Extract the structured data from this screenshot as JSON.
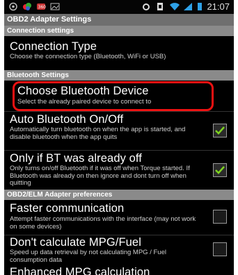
{
  "status_bar": {
    "time": "21:07",
    "icons_left": [
      "signal-app-icon",
      "colorful-app-icon",
      "messaging-icon",
      "photo-icon"
    ],
    "icons_right": [
      "alarm-icon",
      "sim-icon",
      "wifi-icon",
      "cell-signal-icon",
      "battery-icon"
    ]
  },
  "title": "OBD2 Adapter Settings",
  "sections": {
    "connection": "Connection settings",
    "bluetooth": "Bluetooth Settings",
    "adapter": "OBD2/ELM Adapter preferences"
  },
  "items": {
    "connection_type": {
      "title": "Connection Type",
      "summary": "Choose the connection type (Bluetooth, WiFi or USB)"
    },
    "choose_device": {
      "title": "Choose Bluetooth Device",
      "summary": "Select the already paired device to connect to"
    },
    "auto_bt": {
      "title": "Auto Bluetooth On/Off",
      "summary": "Automatically turn bluetooth on when the app is started, and disable bluetooth when the app quits",
      "checked": true
    },
    "only_if_bt": {
      "title": "Only if BT was already off",
      "summary": "Only turns on/off Bluetooth if it was off when Torque started. If Bluetooth was already on then ignore and dont turn off when quitting",
      "checked": true
    },
    "faster_comm": {
      "title": "Faster communication",
      "summary": "Attempt faster communications with the interface (may not work on some devices)",
      "checked": false
    },
    "dont_calc_mpg": {
      "title": "Don't calculate MPG/Fuel",
      "summary": "Speed up data retrieval by not calculating MPG / Fuel consumption data",
      "checked": false
    },
    "enhanced_mpg": {
      "title": "Enhanced MPG calculation"
    }
  },
  "colors": {
    "highlight": "#ee1111",
    "check": "#7ed321"
  }
}
